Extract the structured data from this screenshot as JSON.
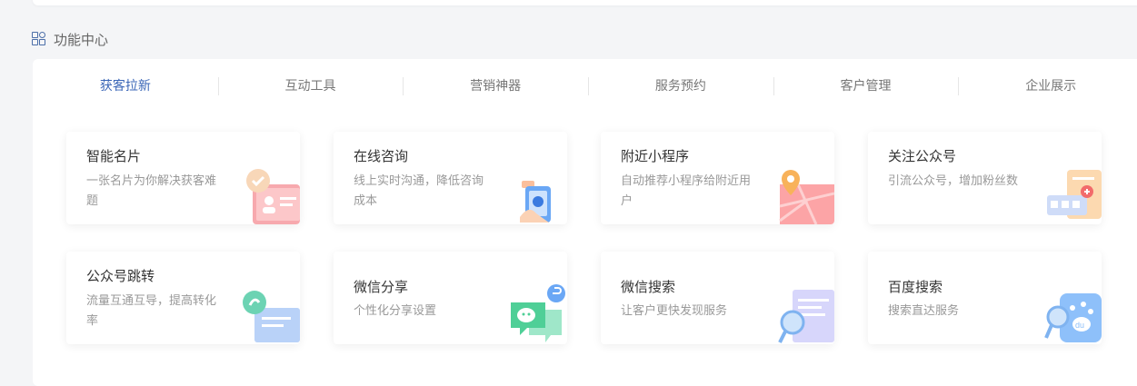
{
  "section": {
    "title": "功能中心",
    "icon": "grid-icon"
  },
  "tabs": [
    {
      "label": "获客拉新",
      "active": true
    },
    {
      "label": "互动工具",
      "active": false
    },
    {
      "label": "营销神器",
      "active": false
    },
    {
      "label": "服务预约",
      "active": false
    },
    {
      "label": "客户管理",
      "active": false
    },
    {
      "label": "企业展示",
      "active": false
    }
  ],
  "cards": [
    {
      "title": "智能名片",
      "desc": "一张名片为你解决获客难题",
      "icon": "business-card-icon"
    },
    {
      "title": "在线咨询",
      "desc": "线上实时沟通，降低咨询成本",
      "icon": "phone-consult-icon"
    },
    {
      "title": "附近小程序",
      "desc": "自动推荐小程序给附近用户",
      "icon": "map-pin-icon"
    },
    {
      "title": "关注公众号",
      "desc": "引流公众号，增加粉丝数",
      "icon": "subscribe-icon"
    },
    {
      "title": "公众号跳转",
      "desc": "流量互通互导，提高转化率",
      "icon": "redirect-icon"
    },
    {
      "title": "微信分享",
      "desc": "个性化分享设置",
      "icon": "wechat-share-icon"
    },
    {
      "title": "微信搜索",
      "desc": "让客户更快发现服务",
      "icon": "wechat-search-icon"
    },
    {
      "title": "百度搜索",
      "desc": "搜索直达服务",
      "icon": "baidu-search-icon"
    }
  ]
}
